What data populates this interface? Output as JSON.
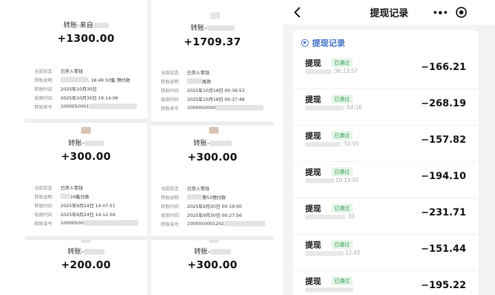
{
  "collage": {
    "cards": [
      {
        "title": "转账-来自",
        "amount": "+1300.00",
        "rows": [
          {
            "k": "当前状态",
            "v": "已存入零钱"
          },
          {
            "k": "转账说明",
            "v": ", 18:49 50集 预付款"
          },
          {
            "k": "转账时间",
            "v": "2025年10月30日"
          },
          {
            "k": "收款时间",
            "v": "2025年10月30日 19:14:06"
          },
          {
            "k": "转账单号",
            "v": "1000050001"
          }
        ]
      },
      {
        "title": "转账-",
        "amount": "+1709.37",
        "rows": [
          {
            "k": "当前状态",
            "v": "已存入零钱"
          },
          {
            "k": "转账说明",
            "v": "尾款"
          },
          {
            "k": "转账时间",
            "v": "2025年10月18日 00:36:53"
          },
          {
            "k": "收款时间",
            "v": "2025年10月18日 00:37:48"
          },
          {
            "k": "转账单号",
            "v": "1000050000"
          }
        ]
      },
      {
        "title": "转账-",
        "amount": "+300.00",
        "rows": [
          {
            "k": "当前状态",
            "v": "已存入零钱"
          },
          {
            "k": "转账说明",
            "v": "16集付款"
          },
          {
            "k": "转账时间",
            "v": "2025年9月24日 14:07:51"
          },
          {
            "k": "收款时间",
            "v": "2025年9月24日 14:12:56"
          },
          {
            "k": "转账单号",
            "v": "10000500"
          }
        ]
      },
      {
        "title": "转账-",
        "amount": "+300.00",
        "rows": [
          {
            "k": "当前状态",
            "v": "已存入零钱"
          },
          {
            "k": "转账说明",
            "v": "第53预付款"
          },
          {
            "k": "转账时间",
            "v": "2025年9月30日 00:19:00"
          },
          {
            "k": "收款时间",
            "v": "2025年9月30日 00:27:56"
          },
          {
            "k": "转账单号",
            "v": "1000050001202"
          }
        ]
      },
      {
        "title": "转账-",
        "amount": "+200.00",
        "rows": []
      },
      {
        "title": "转账-",
        "amount": "+300.00",
        "rows": []
      }
    ]
  },
  "phone": {
    "title": "提现记录",
    "section_label": "提现记录",
    "records": [
      {
        "title": "提现",
        "badge": "已通过",
        "time": ":36:13:57",
        "amount": "−166.21"
      },
      {
        "title": "提现",
        "badge": "已通过",
        "time": ":54:16",
        "amount": "−268.19"
      },
      {
        "title": "提现",
        "badge": "已通过",
        "time": ":51:05",
        "amount": "−157.82"
      },
      {
        "title": "提现",
        "badge": "已通过",
        "time": "10:13:02",
        "amount": "−194.10"
      },
      {
        "title": "提现",
        "badge": "已通过",
        "time": ":33",
        "amount": "−231.71"
      },
      {
        "title": "提现",
        "badge": "已通过",
        "time": "12:43",
        "amount": "−151.44"
      },
      {
        "title": "提现",
        "badge": "已通过",
        "time": "",
        "amount": "−195.22"
      }
    ]
  },
  "icons": {
    "back": "chevron-left-icon",
    "more": "more-dots-icon",
    "close": "target-close-icon",
    "section": "record-circle-icon"
  },
  "colors": {
    "accent_blue": "#3f6fc6",
    "badge_green": "#2f9d4f",
    "badge_bg": "#e5f5e9"
  }
}
